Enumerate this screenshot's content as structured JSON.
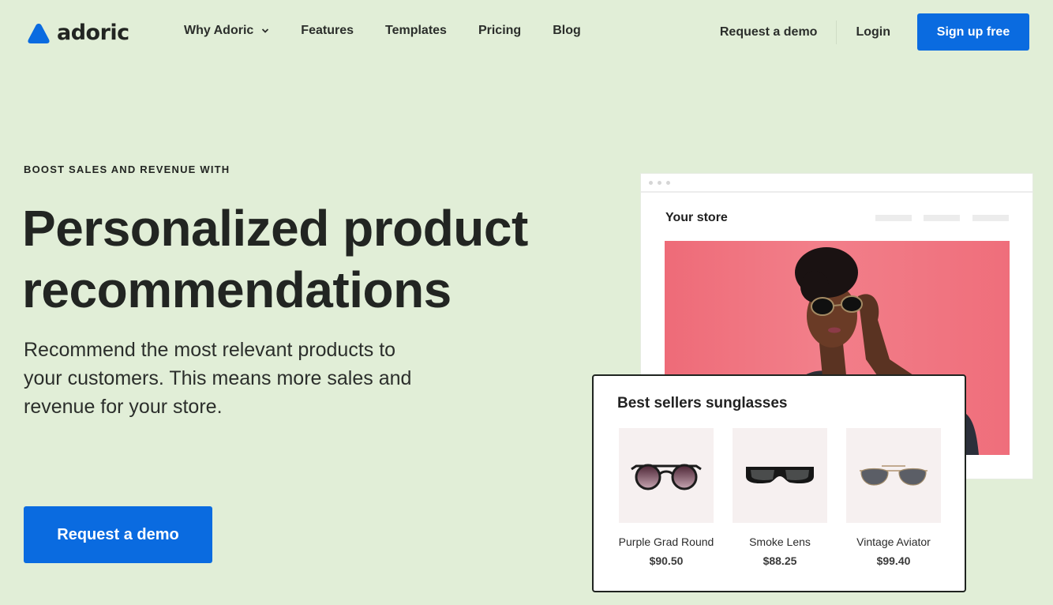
{
  "brand": {
    "name": "adoric",
    "accent": "#0a6be0",
    "background": "#e1eed7"
  },
  "nav": {
    "items": [
      {
        "label": "Why Adoric",
        "has_dropdown": true
      },
      {
        "label": "Features"
      },
      {
        "label": "Templates"
      },
      {
        "label": "Pricing"
      },
      {
        "label": "Blog"
      }
    ],
    "request_demo": "Request a demo",
    "login": "Login",
    "signup": "Sign up free"
  },
  "hero": {
    "eyebrow": "BOOST SALES AND REVENUE WITH",
    "headline_line1": "Personalized product",
    "headline_line2": "recommendations",
    "subtext": "Recommend the most relevant products to your customers. This means more sales and revenue for your store.",
    "cta": "Request a demo"
  },
  "mockup": {
    "store_title": "Your store",
    "widget": {
      "title": "Best sellers sunglasses",
      "products": [
        {
          "name": "Purple Grad Round",
          "price": "$90.50",
          "icon": "round-sunglasses-icon"
        },
        {
          "name": "Smoke Lens",
          "price": "$88.25",
          "icon": "wrap-sunglasses-icon"
        },
        {
          "name": "Vintage Aviator",
          "price": "$99.40",
          "icon": "aviator-sunglasses-icon"
        }
      ]
    }
  }
}
